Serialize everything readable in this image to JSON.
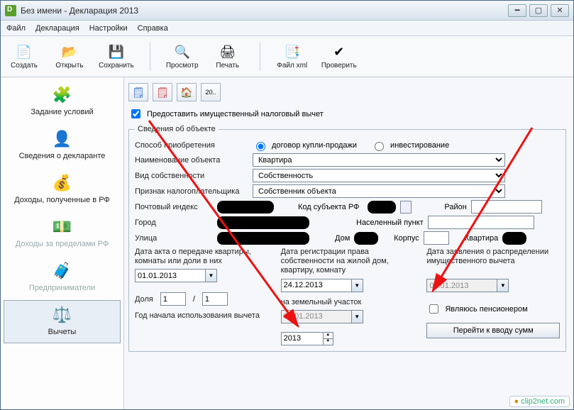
{
  "window": {
    "title": "Без имени - Декларация 2013"
  },
  "menu": {
    "file": "Файл",
    "declaration": "Декларация",
    "settings": "Настройки",
    "help": "Справка"
  },
  "toolbar": {
    "create": "Создать",
    "open": "Открыть",
    "save": "Сохранить",
    "preview": "Просмотр",
    "print": "Печать",
    "filexml": "Файл xml",
    "check": "Проверить"
  },
  "sidebar": {
    "conditions": "Задание условий",
    "declarant": "Сведения о декларанте",
    "income_rf": "Доходы, полученные в РФ",
    "income_abroad": "Доходы за пределами РФ",
    "entrepreneurs": "Предприниматели",
    "deductions": "Вычеты"
  },
  "subtoolbar": {
    "b1": "✔",
    "b2": "✔",
    "b3": "⌂",
    "b4": "20.."
  },
  "main": {
    "grant_label": "Предоставить имущественный налоговый вычет",
    "section_title": "Сведения об объекте",
    "acquire_label": "Способ приобретения",
    "acquire_sale": "договор купли-продажи",
    "acquire_invest": "инвестирование",
    "obj_name_label": "Наименование объекта",
    "obj_name_value": "Квартира",
    "ownership_label": "Вид собственности",
    "ownership_value": "Собственность",
    "taxpayer_label": "Признак налогоплательщика",
    "taxpayer_value": "Собственник объекта",
    "postal_label": "Почтовый индекс",
    "subject_label": "Код субъекта РФ",
    "district_label": "Район",
    "city_label": "Город",
    "locality_label": "Населенный пункт",
    "street_label": "Улица",
    "house_label": "Дом",
    "building_label": "Корпус",
    "flat_label": "Квартира",
    "date_act_label": "Дата акта о передаче квартиры, комнаты или доли в них",
    "date_act_value": "01.01.2013",
    "date_reg_label": "Дата регистрации права собственности на жилой дом, квартиру, комнату",
    "date_reg_value": "24.12.2013",
    "date_land_label": "на земельный участок",
    "date_land_value": "01.01.2013",
    "date_appl_label": "Дата заявления о распределении имущественного вычета",
    "date_appl_value": "01.01.2013",
    "share_label": "Доля",
    "share_num": "1",
    "share_den": "1",
    "year_label": "Год начала использования вычета",
    "year_value": "2013",
    "pensioner_label": "Являюсь пенсионером",
    "goto_btn": "Перейти к вводу сумм"
  },
  "watermark": "clip2net.com"
}
